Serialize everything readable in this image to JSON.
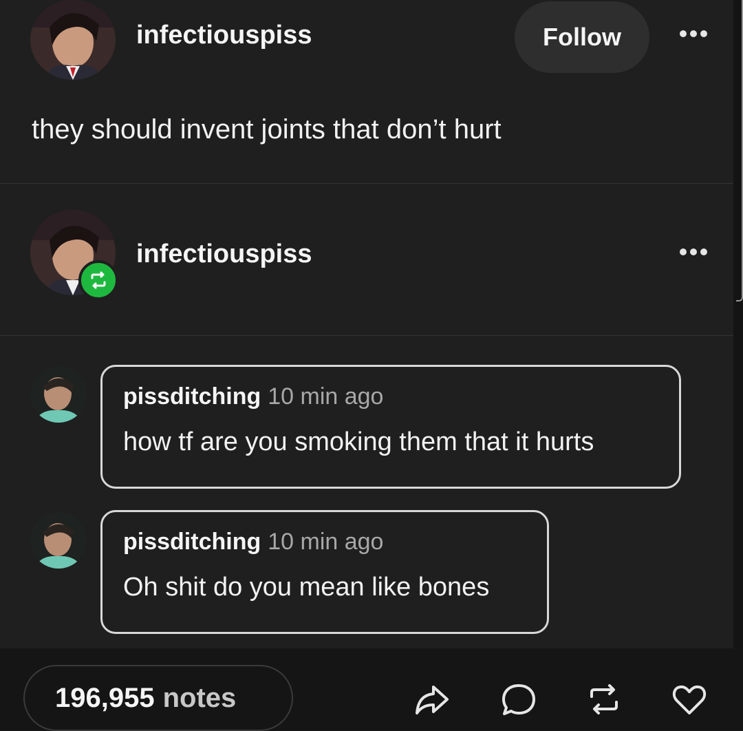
{
  "original_post": {
    "username": "infectiouspiss",
    "follow_label": "Follow",
    "text": "they should invent joints that don’t hurt",
    "more_icon": "ellipsis-icon"
  },
  "reblog": {
    "username": "infectiouspiss",
    "badge_icon": "reblog-icon",
    "badge_color": "#1fb83f",
    "more_icon": "ellipsis-icon"
  },
  "replies": [
    {
      "username": "pissditching",
      "timestamp": "10 min ago",
      "text": "how tf are you smoking them that it hurts"
    },
    {
      "username": "pissditching",
      "timestamp": "10 min ago",
      "text": "Oh shit do you mean like bones"
    }
  ],
  "footer": {
    "notes_count": "196,955",
    "notes_label": "notes",
    "actions": [
      "share-icon",
      "reply-icon",
      "reblog-icon",
      "like-icon"
    ]
  },
  "colors": {
    "background": "#1f1f1f",
    "footer": "#151515",
    "reblog_green": "#1fb83f"
  }
}
